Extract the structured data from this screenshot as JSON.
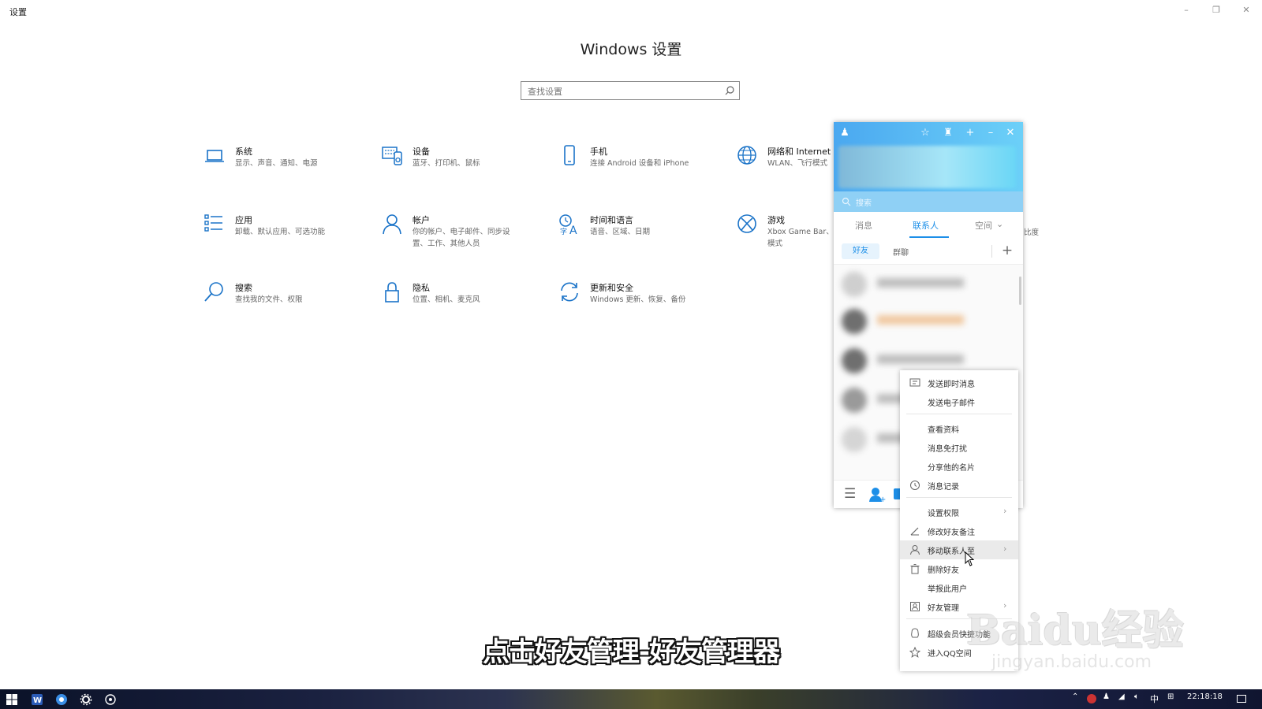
{
  "window": {
    "title": "设置",
    "controls": {
      "minimize": "–",
      "restore": "❐",
      "close": "✕"
    }
  },
  "page_title": "Windows 设置",
  "search": {
    "placeholder": "查找设置",
    "value": "查找设置"
  },
  "tiles": [
    {
      "name": "系统",
      "desc": "显示、声音、通知、电源",
      "icon": "laptop-icon"
    },
    {
      "name": "设备",
      "desc": "蓝牙、打印机、鼠标",
      "icon": "keyboard-icon"
    },
    {
      "name": "手机",
      "desc": "连接 Android 设备和 iPhone",
      "icon": "phone-icon"
    },
    {
      "name": "网络和 Internet",
      "desc": "WLAN、飞行模式",
      "icon": "globe-icon"
    },
    {
      "name": "应用",
      "desc": "卸载、默认应用、可选功能",
      "icon": "apps-list-icon"
    },
    {
      "name": "帐户",
      "desc": "你的帐户、电子邮件、同步设置、工作、其他人员",
      "desc_line1": "你的帐户、电子邮件、同步设",
      "desc_line2": "置、工作、其他人员",
      "icon": "person-icon"
    },
    {
      "name": "时间和语言",
      "desc": "语音、区域、日期",
      "icon": "time-language-icon"
    },
    {
      "name": "游戏",
      "desc": "Xbox Game Bar、",
      "desc_line2": "模式",
      "icon": "xbox-icon"
    },
    {
      "name": "搜索",
      "desc": "查找我的文件、权限",
      "icon": "search-icon"
    },
    {
      "name": "隐私",
      "desc": "位置、相机、麦克风",
      "icon": "lock-icon"
    },
    {
      "name": "更新和安全",
      "desc": "Windows 更新、恢复、备份",
      "icon": "refresh-icon"
    }
  ],
  "partial_text": "比度",
  "qq": {
    "search_placeholder": "搜索",
    "tabs": [
      "消息",
      "联系人",
      "空间"
    ],
    "active_tab": "联系人",
    "subtabs": [
      "好友",
      "群聊"
    ],
    "add_label": "+",
    "accent": "#1d8fe8"
  },
  "context_menu": {
    "items": [
      {
        "label": "发送即时消息",
        "icon": "message-icon"
      },
      {
        "label": "发送电子邮件",
        "icon": ""
      },
      {
        "label": "查看资料",
        "icon": ""
      },
      {
        "label": "消息免打扰",
        "icon": ""
      },
      {
        "label": "分享他的名片",
        "icon": ""
      },
      {
        "label": "消息记录",
        "icon": "clock-icon"
      },
      {
        "label": "设置权限",
        "icon": "",
        "submenu": true
      },
      {
        "label": "修改好友备注",
        "icon": "pencil-icon"
      },
      {
        "label": "移动联系人至",
        "icon": "person-icon",
        "submenu": true,
        "hover": true
      },
      {
        "label": "删除好友",
        "icon": "trash-icon"
      },
      {
        "label": "举报此用户",
        "icon": ""
      },
      {
        "label": "好友管理",
        "icon": "contacts-icon",
        "submenu": true
      },
      {
        "label": "超级会员快捷功能",
        "icon": "penguin-icon"
      },
      {
        "label": "进入QQ空间",
        "icon": "star-icon"
      }
    ],
    "arrow": "›"
  },
  "subtitle": "点击好友管理-好友管理器",
  "watermark": {
    "logo": "Baidu经验",
    "url": "jingyan.baidu.com"
  },
  "taskbar": {
    "time": "22:18:18",
    "ime": "中",
    "tray_icons": [
      "chevron-up-icon",
      "app-tray-icon",
      "qq-tray-icon",
      "network-icon",
      "volume-mute-icon",
      "ime-icon",
      "keyboard-layout-icon",
      "notification-icon"
    ]
  }
}
